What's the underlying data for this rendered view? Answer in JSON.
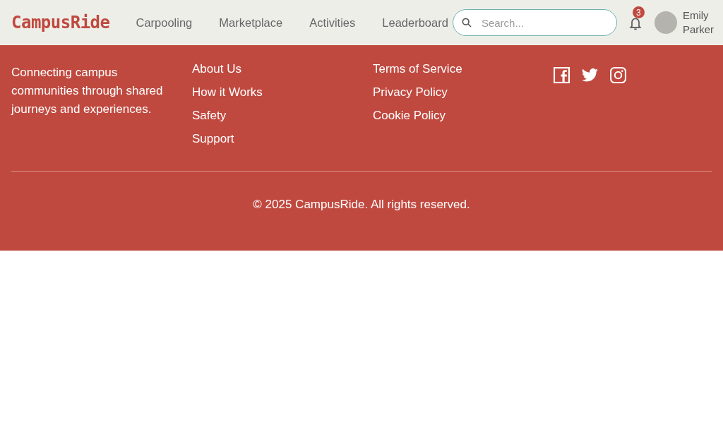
{
  "header": {
    "logo": "CampusRide",
    "nav": [
      {
        "label": "Carpooling"
      },
      {
        "label": "Marketplace"
      },
      {
        "label": "Activities"
      },
      {
        "label": "Leaderboard"
      }
    ],
    "search": {
      "placeholder": "Search..."
    },
    "notifications": {
      "count": "3"
    },
    "user": {
      "first_name": "Emily",
      "last_name": "Parker"
    }
  },
  "footer": {
    "brand": {
      "tagline": "Connecting campus communities through shared journeys and experiences."
    },
    "columns": [
      {
        "links": [
          "About Us",
          "How it Works",
          "Safety",
          "Support"
        ]
      },
      {
        "links": [
          "Terms of Service",
          "Privacy Policy",
          "Cookie Policy"
        ]
      }
    ],
    "connect": {
      "social": [
        {
          "kind": "facebook"
        },
        {
          "kind": "twitter"
        },
        {
          "kind": "instagram"
        }
      ]
    },
    "copyright": "© 2025 CampusRide. All rights reserved."
  }
}
